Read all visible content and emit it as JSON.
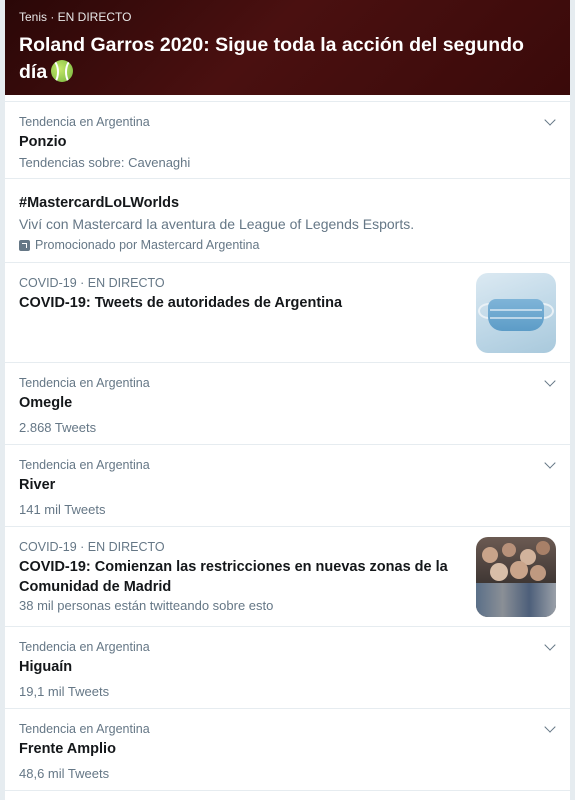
{
  "hero": {
    "meta": "Tenis · EN DIRECTO",
    "title": "Roland Garros 2020: Sigue toda la acción del segundo día"
  },
  "items": [
    {
      "meta": "Tendencia en Argentina",
      "name": "Ponzio",
      "sub": "Tendencias sobre: Cavenaghi"
    },
    {
      "name": "#MastercardLoLWorlds",
      "desc": "Viví con Mastercard la aventura de League of Legends Esports.",
      "promo": "Promocionado por Mastercard Argentina"
    },
    {
      "meta": "COVID-19 · EN DIRECTO",
      "name": "COVID-19: Tweets de autoridades de Argentina",
      "image": "face-mask-image"
    },
    {
      "meta": "Tendencia en Argentina",
      "name": "Omegle",
      "sub": "2.868 Tweets"
    },
    {
      "meta": "Tendencia en Argentina",
      "name": "River",
      "sub": "141 mil Tweets"
    },
    {
      "meta": "COVID-19 · EN DIRECTO",
      "name": "COVID-19: Comienzan las restricciones en nuevas zonas de la Comunidad de Madrid",
      "sub": "38 mil personas están twitteando sobre esto",
      "image": "crowd-image"
    },
    {
      "meta": "Tendencia en Argentina",
      "name": "Higuaín",
      "sub": "19,1 mil Tweets"
    },
    {
      "meta": "Tendencia en Argentina",
      "name": "Frente Amplio",
      "sub": "48,6 mil Tweets"
    }
  ],
  "icons": {
    "more": "chevron-down-icon",
    "hero_emoji": "tennis-ball-icon",
    "promoted": "promoted-icon"
  }
}
